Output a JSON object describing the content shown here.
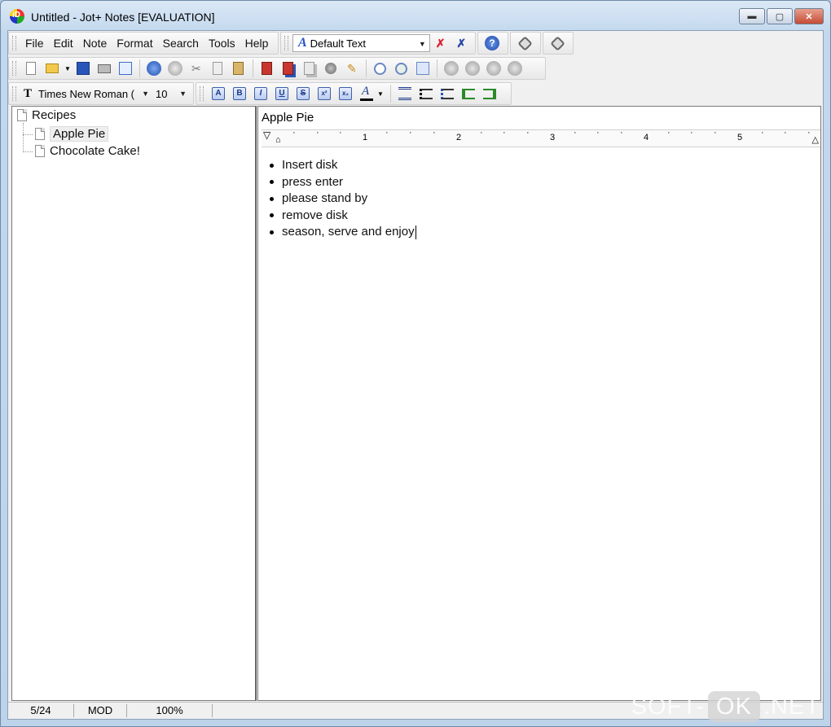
{
  "window": {
    "title": "Untitled - Jot+ Notes [EVALUATION]",
    "app_icon_label": "iD",
    "controls": {
      "minimize": "▬",
      "maximize": "▢",
      "close": "✕"
    }
  },
  "menu": {
    "items": [
      "File",
      "Edit",
      "Note",
      "Format",
      "Search",
      "Tools",
      "Help"
    ]
  },
  "style_selector": {
    "value": "Default Text"
  },
  "font_selector": {
    "font": "Times New Roman (",
    "size": "10"
  },
  "tree": {
    "root": "Recipes",
    "children": [
      "Apple Pie",
      "Chocolate Cake!"
    ],
    "selected": "Apple Pie"
  },
  "note": {
    "title": "Apple Pie",
    "ruler_marks": [
      "1",
      "2",
      "3",
      "4",
      "5"
    ],
    "bullets": [
      "Insert disk",
      "press enter",
      "please stand by",
      "remove disk",
      "season, serve and enjoy"
    ]
  },
  "status": {
    "position": "5/24",
    "mode": "MOD",
    "zoom": "100%"
  },
  "watermark": {
    "left": "SOFT-",
    "mid": "OK",
    "right": ".NET"
  }
}
